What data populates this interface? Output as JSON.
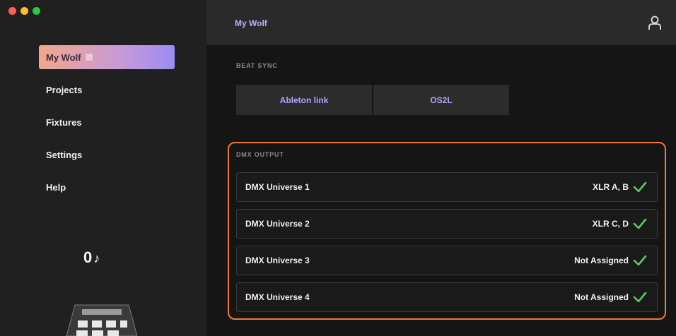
{
  "window": {
    "controls": [
      "close",
      "minimize",
      "maximize"
    ]
  },
  "sidebar": {
    "items": [
      {
        "label": "My Wolf",
        "active": true
      },
      {
        "label": "Projects",
        "active": false
      },
      {
        "label": "Fixtures",
        "active": false
      },
      {
        "label": "Settings",
        "active": false
      },
      {
        "label": "Help",
        "active": false
      }
    ],
    "counter": {
      "value": "0",
      "icon": "music-note-icon"
    },
    "device_icon": "controller-device-icon"
  },
  "header": {
    "title": "My Wolf",
    "user_icon": "user-icon"
  },
  "beat_sync": {
    "label": "BEAT SYNC",
    "options": [
      {
        "label": "Ableton link"
      },
      {
        "label": "OS2L"
      }
    ]
  },
  "dmx_output": {
    "label": "DMX OUTPUT",
    "universes": [
      {
        "name": "DMX Universe 1",
        "assignment": "XLR A, B",
        "status_icon": "checkmark-icon"
      },
      {
        "name": "DMX Universe 2",
        "assignment": "XLR C, D",
        "status_icon": "checkmark-icon"
      },
      {
        "name": "DMX Universe 3",
        "assignment": "Not Assigned",
        "status_icon": "checkmark-icon"
      },
      {
        "name": "DMX Universe 4",
        "assignment": "Not Assigned",
        "status_icon": "checkmark-icon"
      }
    ]
  },
  "colors": {
    "accent_purple": "#aaa8ff",
    "highlight_orange": "#f07a36",
    "check_green": "#5fc95b"
  }
}
